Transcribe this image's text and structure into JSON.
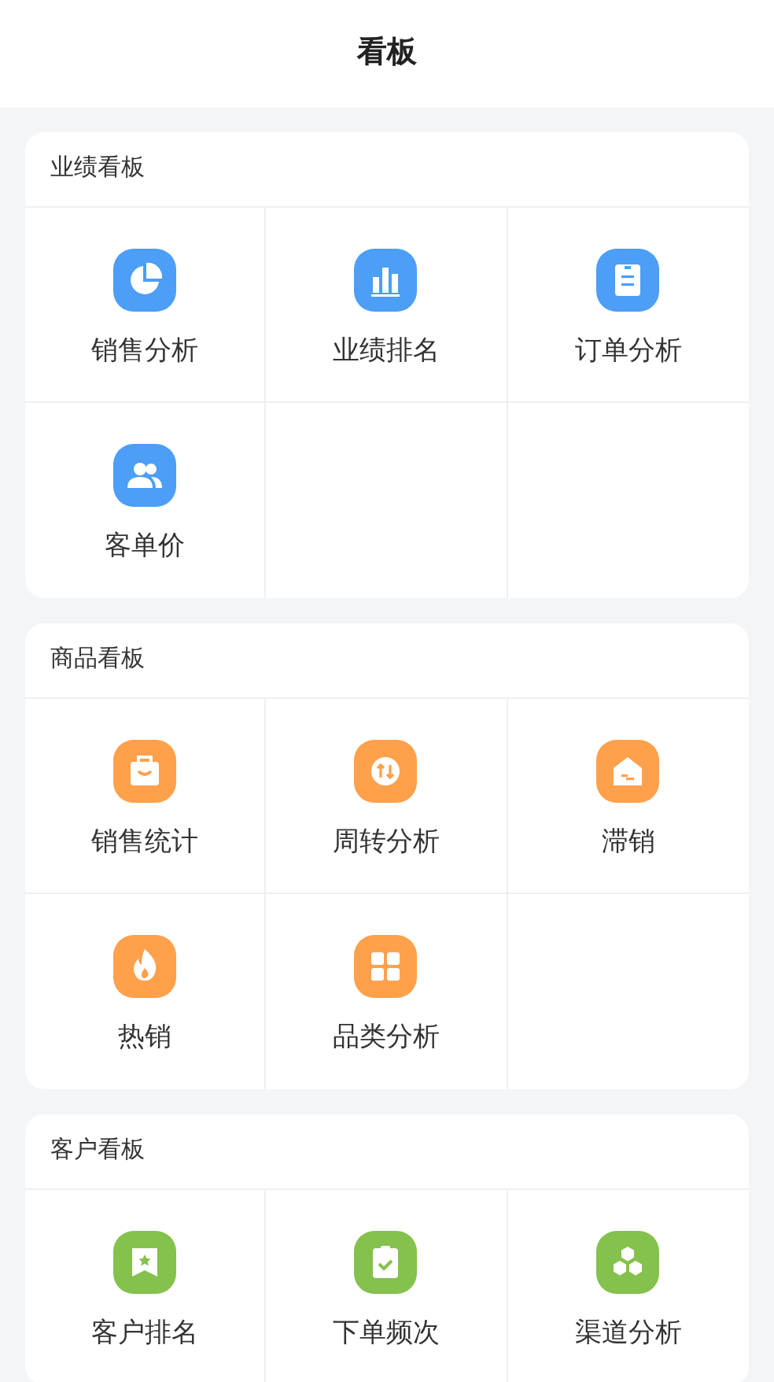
{
  "header": {
    "title": "看板"
  },
  "sections": [
    {
      "title": "业绩看板",
      "color": "#4c9ef6",
      "items": [
        {
          "label": "销售分析",
          "kind": "pie"
        },
        {
          "label": "业绩排名",
          "kind": "bars"
        },
        {
          "label": "订单分析",
          "kind": "clipboard"
        },
        {
          "label": "客单价",
          "kind": "people"
        }
      ]
    },
    {
      "title": "商品看板",
      "color": "#ffa04b",
      "items": [
        {
          "label": "销售统计",
          "kind": "bag"
        },
        {
          "label": "周转分析",
          "kind": "swap"
        },
        {
          "label": "滞销",
          "kind": "box"
        },
        {
          "label": "热销",
          "kind": "flame"
        },
        {
          "label": "品类分析",
          "kind": "grid"
        }
      ]
    },
    {
      "title": "客户看板",
      "color": "#85c14d",
      "items": [
        {
          "label": "客户排名",
          "kind": "bookmark"
        },
        {
          "label": "下单频次",
          "kind": "check"
        },
        {
          "label": "渠道分析",
          "kind": "hex"
        }
      ]
    }
  ]
}
